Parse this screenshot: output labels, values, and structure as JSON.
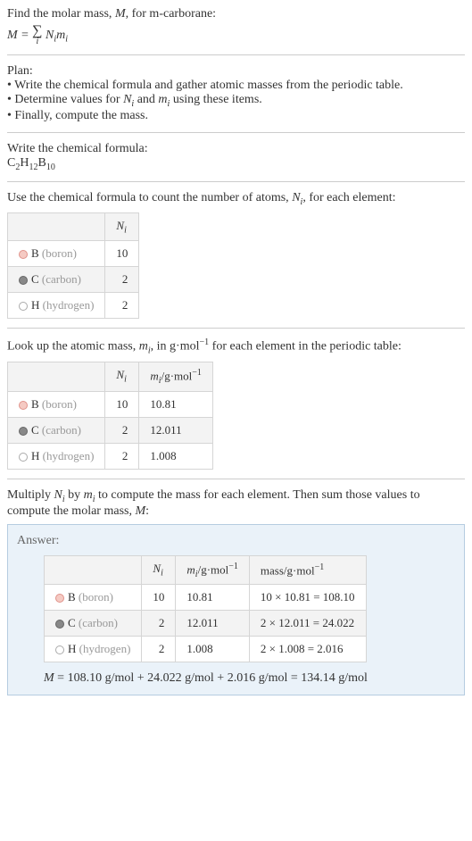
{
  "intro": {
    "line1_prefix": "Find the molar mass, ",
    "line1_var": "M",
    "line1_suffix": ", for m-carborane:",
    "formula_lhs": "M",
    "formula_eq": " = ",
    "sum_lower": "i",
    "formula_rhs1": "N",
    "formula_rhs1_sub": "i",
    "formula_rhs2": "m",
    "formula_rhs2_sub": "i"
  },
  "plan": {
    "title": "Plan:",
    "b1": "• Write the chemical formula and gather atomic masses from the periodic table.",
    "b2_prefix": "• Determine values for ",
    "b2_n": "N",
    "b2_nsub": "i",
    "b2_mid": " and ",
    "b2_m": "m",
    "b2_msub": "i",
    "b2_suffix": " using these items.",
    "b3": "• Finally, compute the mass."
  },
  "chem": {
    "title": "Write the chemical formula:",
    "c": "C",
    "c_n": "2",
    "h": "H",
    "h_n": "12",
    "b": "B",
    "b_n": "10"
  },
  "count": {
    "title_prefix": "Use the chemical formula to count the number of atoms, ",
    "title_var": "N",
    "title_sub": "i",
    "title_suffix": ", for each element:",
    "header_n": "N",
    "header_n_sub": "i",
    "rows": [
      {
        "sym": "B",
        "name": "(boron)",
        "n": "10",
        "dot": "dot-b"
      },
      {
        "sym": "C",
        "name": "(carbon)",
        "n": "2",
        "dot": "dot-c"
      },
      {
        "sym": "H",
        "name": "(hydrogen)",
        "n": "2",
        "dot": "dot-h"
      }
    ]
  },
  "mass": {
    "title_prefix": "Look up the atomic mass, ",
    "title_var": "m",
    "title_sub": "i",
    "title_mid": ", in g·mol",
    "title_exp": "−1",
    "title_suffix": " for each element in the periodic table:",
    "header_n": "N",
    "header_n_sub": "i",
    "header_m": "m",
    "header_m_sub": "i",
    "header_m_unit": "/g·mol",
    "header_m_exp": "−1",
    "rows": [
      {
        "sym": "B",
        "name": "(boron)",
        "n": "10",
        "m": "10.81",
        "dot": "dot-b"
      },
      {
        "sym": "C",
        "name": "(carbon)",
        "n": "2",
        "m": "12.011",
        "dot": "dot-c"
      },
      {
        "sym": "H",
        "name": "(hydrogen)",
        "n": "2",
        "m": "1.008",
        "dot": "dot-h"
      }
    ]
  },
  "multiply": {
    "text_p1": "Multiply ",
    "n": "N",
    "nsub": "i",
    "text_p2": " by ",
    "m": "m",
    "msub": "i",
    "text_p3": " to compute the mass for each element. Then sum those values to compute the molar mass, ",
    "mvar": "M",
    "text_p4": ":"
  },
  "answer": {
    "label": "Answer:",
    "header_n": "N",
    "header_n_sub": "i",
    "header_m": "m",
    "header_m_sub": "i",
    "header_m_unit": "/g·mol",
    "header_m_exp": "−1",
    "header_mass": "mass/g·mol",
    "header_mass_exp": "−1",
    "rows": [
      {
        "sym": "B",
        "name": "(boron)",
        "n": "10",
        "m": "10.81",
        "calc": "10 × 10.81 = 108.10",
        "dot": "dot-b"
      },
      {
        "sym": "C",
        "name": "(carbon)",
        "n": "2",
        "m": "12.011",
        "calc": "2 × 12.011 = 24.022",
        "dot": "dot-c"
      },
      {
        "sym": "H",
        "name": "(hydrogen)",
        "n": "2",
        "m": "1.008",
        "calc": "2 × 1.008 = 2.016",
        "dot": "dot-h"
      }
    ],
    "result_var": "M",
    "result_text": " = 108.10 g/mol + 24.022 g/mol + 2.016 g/mol = 134.14 g/mol"
  }
}
